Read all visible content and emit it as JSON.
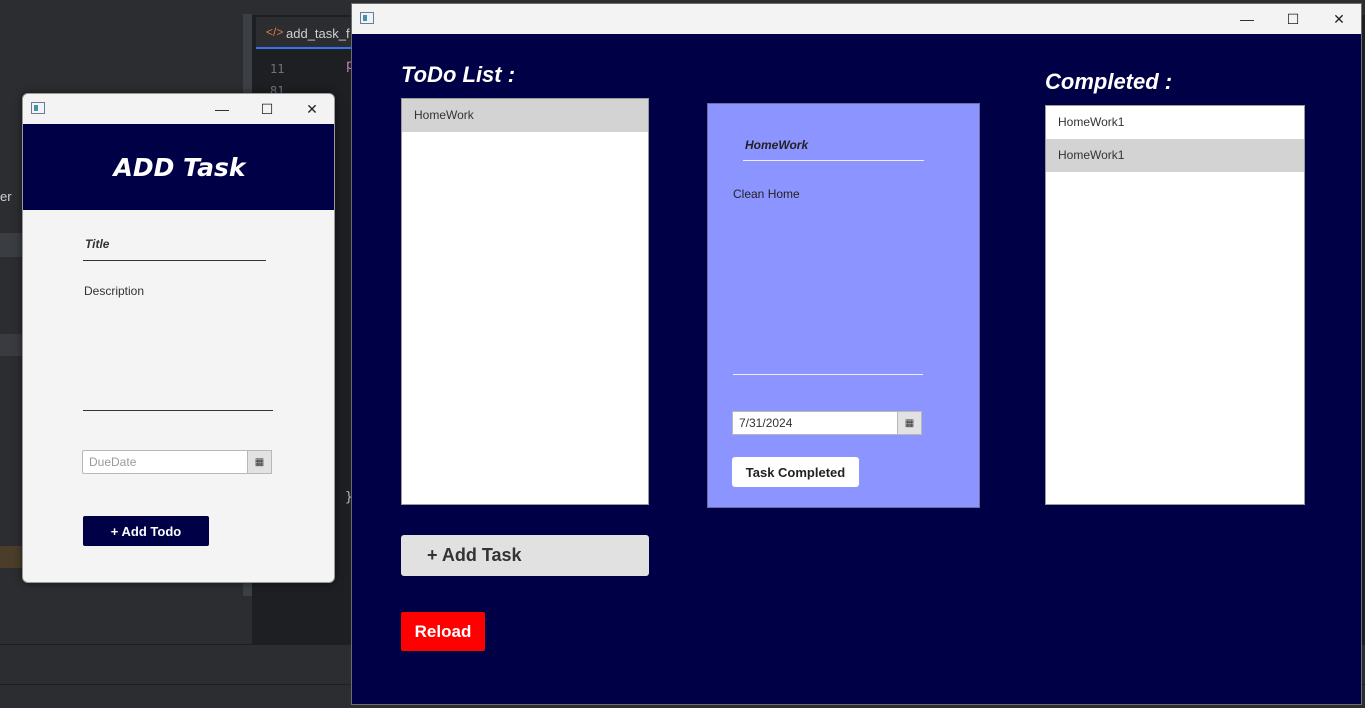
{
  "ide": {
    "tab_icon": "</>",
    "tab_label": "add_task_f",
    "line_numbers": [
      "11",
      "81"
    ],
    "code_snippet": "p",
    "brace": "}",
    "left_pane_text": "er"
  },
  "add_window": {
    "minimize": "—",
    "maximize": "☐",
    "close": "✕",
    "header": "ADD Task",
    "title_placeholder": "Title",
    "description_placeholder": "Description",
    "duedate_placeholder": "DueDate",
    "calendar_icon": "▦",
    "add_todo_label": "+ Add Todo"
  },
  "main_window": {
    "minimize": "—",
    "maximize": "☐",
    "close": "✕",
    "todo_heading": "ToDo List :",
    "completed_heading": "Completed :",
    "todo_items": [
      "HomeWork"
    ],
    "completed_items": [
      "HomeWork1",
      "HomeWork1"
    ],
    "detail": {
      "title": "HomeWork",
      "description": "Clean Home",
      "date": "7/31/2024",
      "calendar_icon": "▦",
      "complete_label": "Task Completed"
    },
    "add_task_label": "+ Add Task",
    "reload_label": "Reload"
  },
  "colors": {
    "navy": "#000046",
    "card": "#8c94ff",
    "reload": "#ff0000"
  }
}
